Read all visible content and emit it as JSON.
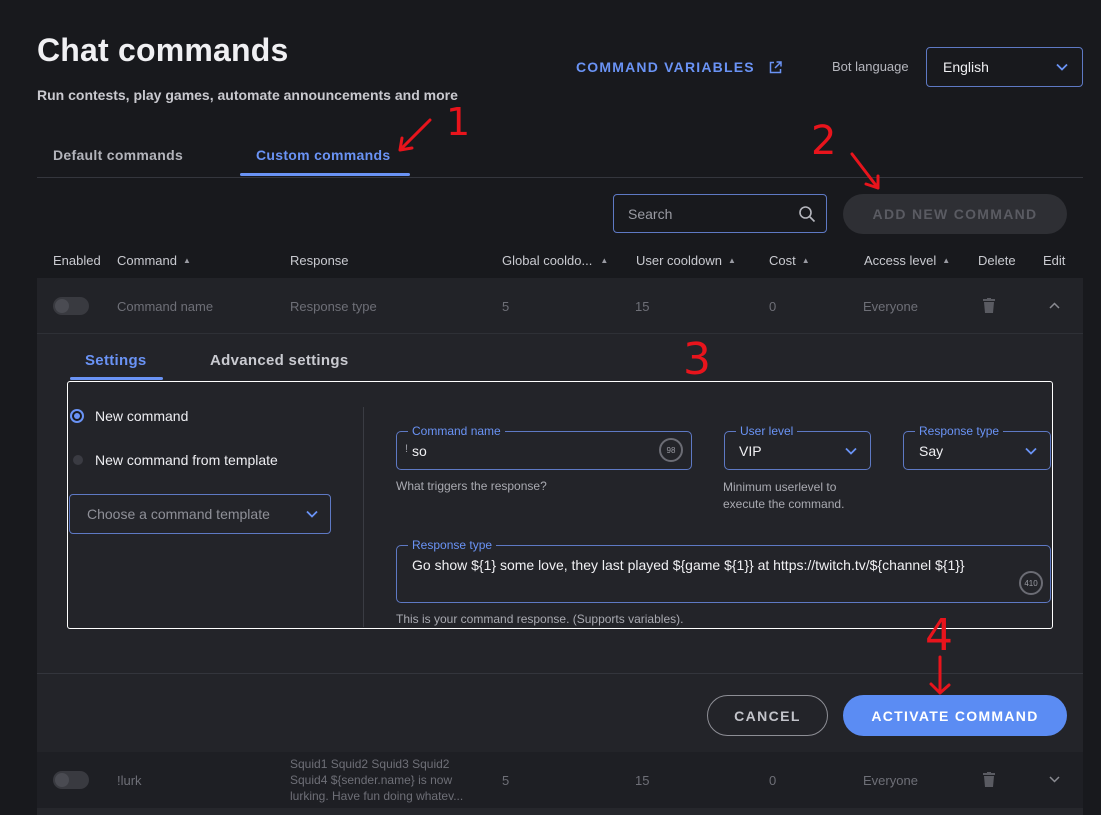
{
  "header": {
    "title": "Chat commands",
    "subtitle": "Run contests, play games, automate announcements and more",
    "command_variables_label": "COMMAND VARIABLES",
    "bot_language_label": "Bot language",
    "bot_language_value": "English"
  },
  "tabs": {
    "default_label": "Default commands",
    "custom_label": "Custom commands",
    "active": "custom"
  },
  "toolbar": {
    "search_placeholder": "Search",
    "add_new_label": "ADD NEW COMMAND"
  },
  "table": {
    "columns": [
      "Enabled",
      "Command",
      "Response",
      "Global cooldo...",
      "User cooldown",
      "Cost",
      "Access level",
      "Delete",
      "Edit"
    ],
    "rows": [
      {
        "command": "Command name",
        "response": "Response type",
        "global_cooldown": "5",
        "user_cooldown": "15",
        "cost": "0",
        "access_level": "Everyone",
        "expanded": true
      },
      {
        "command": "!lurk",
        "response_lines": [
          "Squid1 Squid2 Squid3 Squid2",
          "Squid4 ${sender.name} is now",
          "lurking. Have fun doing whatev..."
        ],
        "global_cooldown": "5",
        "user_cooldown": "15",
        "cost": "0",
        "access_level": "Everyone",
        "expanded": false
      }
    ]
  },
  "editor": {
    "subtabs": {
      "settings": "Settings",
      "advanced": "Advanced settings"
    },
    "radio_new": "New command",
    "radio_template": "New command from template",
    "template_placeholder": "Choose a command template",
    "command_name": {
      "label": "Command name",
      "prefix": "!",
      "value": "so",
      "counter": "98",
      "helper": "What triggers the response?"
    },
    "user_level": {
      "label": "User level",
      "value": "VIP",
      "helper_line1": "Minimum userlevel to",
      "helper_line2": "execute the command."
    },
    "response_type_select": {
      "label": "Response type",
      "value": "Say"
    },
    "response": {
      "label": "Response type",
      "value": "Go show ${1} some love, they last played ${game ${1}} at https://twitch.tv/${channel ${1}}",
      "counter": "410",
      "helper": "This is your command response. (Supports variables)."
    },
    "cancel_label": "CANCEL",
    "activate_label": "ACTIVATE COMMAND"
  },
  "annotations": [
    "1",
    "2",
    "3",
    "4"
  ],
  "colors": {
    "accent": "#5b8cf3",
    "background": "#18191d",
    "annotation": "#e8141c"
  }
}
